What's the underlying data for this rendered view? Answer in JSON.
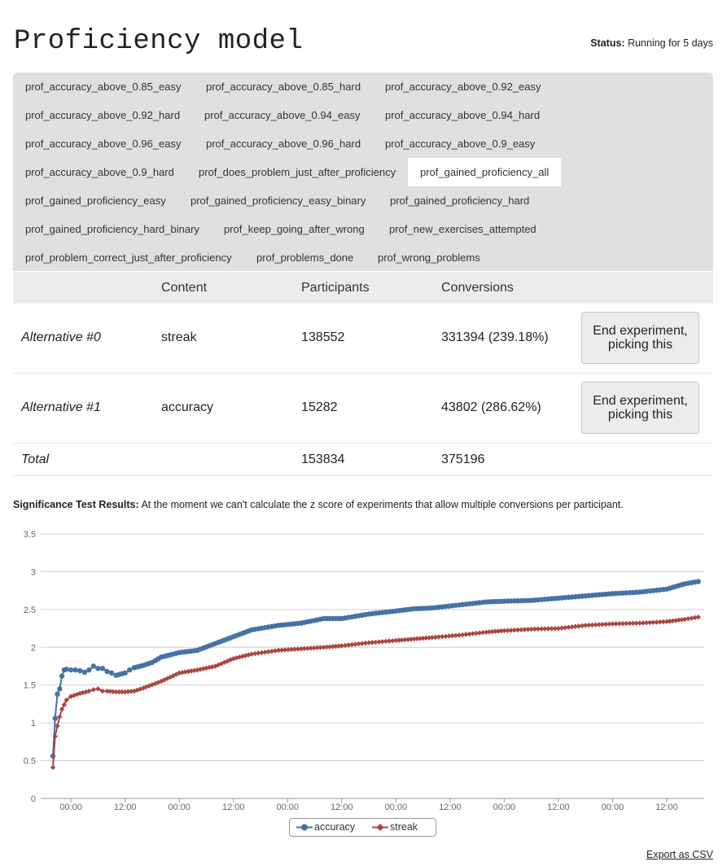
{
  "header": {
    "title": "Proficiency model",
    "status_label": "Status:",
    "status_value": "Running for 5 days"
  },
  "tabs": [
    "prof_accuracy_above_0.85_easy",
    "prof_accuracy_above_0.85_hard",
    "prof_accuracy_above_0.92_easy",
    "prof_accuracy_above_0.92_hard",
    "prof_accuracy_above_0.94_easy",
    "prof_accuracy_above_0.94_hard",
    "prof_accuracy_above_0.96_easy",
    "prof_accuracy_above_0.96_hard",
    "prof_accuracy_above_0.9_easy",
    "prof_accuracy_above_0.9_hard",
    "prof_does_problem_just_after_proficiency",
    "prof_gained_proficiency_all",
    "prof_gained_proficiency_easy",
    "prof_gained_proficiency_easy_binary",
    "prof_gained_proficiency_hard",
    "prof_gained_proficiency_hard_binary",
    "prof_keep_going_after_wrong",
    "prof_new_exercises_attempted",
    "prof_problem_correct_just_after_proficiency",
    "prof_problems_done",
    "prof_wrong_problems"
  ],
  "active_tab": "prof_gained_proficiency_all",
  "table": {
    "headers": {
      "content": "Content",
      "participants": "Participants",
      "conversions": "Conversions"
    },
    "rows": [
      {
        "name": "Alternative #0",
        "content": "streak",
        "participants": "138552",
        "conversions": "331394 (239.18%)",
        "button": "End experiment, picking this"
      },
      {
        "name": "Alternative #1",
        "content": "accuracy",
        "participants": "15282",
        "conversions": "43802 (286.62%)",
        "button": "End experiment, picking this"
      }
    ],
    "total": {
      "name": "Total",
      "participants": "153834",
      "conversions": "375196"
    }
  },
  "significance": {
    "label": "Significance Test Results:",
    "text": "At the moment we can't calculate the z score of experiments that allow multiple conversions per participant."
  },
  "export_label": "Export as CSV",
  "chart_data": {
    "type": "line",
    "ylim": [
      0,
      3.5
    ],
    "yticks": [
      "0",
      "0.5",
      "1",
      "1.5",
      "2",
      "2.5",
      "3",
      "3.5"
    ],
    "xtick_labels": [
      "00:00",
      "12:00",
      "00:00",
      "12:00",
      "00:00",
      "12:00",
      "00:00",
      "12:00",
      "00:00",
      "12:00",
      "00:00",
      "12:00"
    ],
    "xtick_hours": [
      24,
      36,
      48,
      60,
      72,
      84,
      96,
      108,
      120,
      132,
      144,
      156
    ],
    "xlim_hours": [
      17.3,
      164.3
    ],
    "series": [
      {
        "name": "accuracy",
        "color": "#4572a7",
        "marker": "circle",
        "x": [
          20,
          20.5,
          21,
          21.5,
          22,
          22.5,
          23,
          24,
          25,
          26,
          27,
          28,
          29,
          30,
          31,
          32,
          33,
          34,
          36,
          37,
          38,
          40,
          42,
          44,
          48,
          52,
          56,
          60,
          64,
          70,
          75,
          80,
          84,
          90,
          96,
          100,
          104,
          110,
          116,
          120,
          126,
          132,
          138,
          144,
          150,
          156,
          160,
          163
        ],
        "y": [
          0.56,
          1.06,
          1.38,
          1.45,
          1.62,
          1.7,
          1.71,
          1.7,
          1.7,
          1.69,
          1.67,
          1.7,
          1.75,
          1.72,
          1.72,
          1.68,
          1.66,
          1.63,
          1.66,
          1.7,
          1.73,
          1.76,
          1.8,
          1.87,
          1.93,
          1.96,
          2.05,
          2.14,
          2.23,
          2.29,
          2.32,
          2.38,
          2.38,
          2.44,
          2.48,
          2.51,
          2.52,
          2.56,
          2.6,
          2.61,
          2.62,
          2.65,
          2.68,
          2.71,
          2.73,
          2.77,
          2.84,
          2.87
        ]
      },
      {
        "name": "streak",
        "color": "#aa4643",
        "marker": "diamond",
        "x": [
          20,
          20.5,
          21,
          21.5,
          22,
          22.5,
          23,
          24,
          26,
          28,
          29,
          30,
          31,
          32,
          34,
          36,
          38,
          40,
          44,
          48,
          52,
          56,
          60,
          64,
          70,
          75,
          80,
          84,
          90,
          96,
          100,
          104,
          110,
          116,
          120,
          126,
          132,
          138,
          144,
          150,
          156,
          160,
          163
        ],
        "y": [
          0.41,
          0.82,
          0.96,
          1.08,
          1.18,
          1.24,
          1.3,
          1.35,
          1.39,
          1.42,
          1.44,
          1.45,
          1.42,
          1.42,
          1.41,
          1.41,
          1.42,
          1.46,
          1.55,
          1.66,
          1.7,
          1.75,
          1.85,
          1.91,
          1.96,
          1.98,
          2.0,
          2.02,
          2.06,
          2.09,
          2.11,
          2.13,
          2.16,
          2.2,
          2.22,
          2.24,
          2.25,
          2.29,
          2.31,
          2.32,
          2.34,
          2.37,
          2.4
        ]
      }
    ]
  }
}
